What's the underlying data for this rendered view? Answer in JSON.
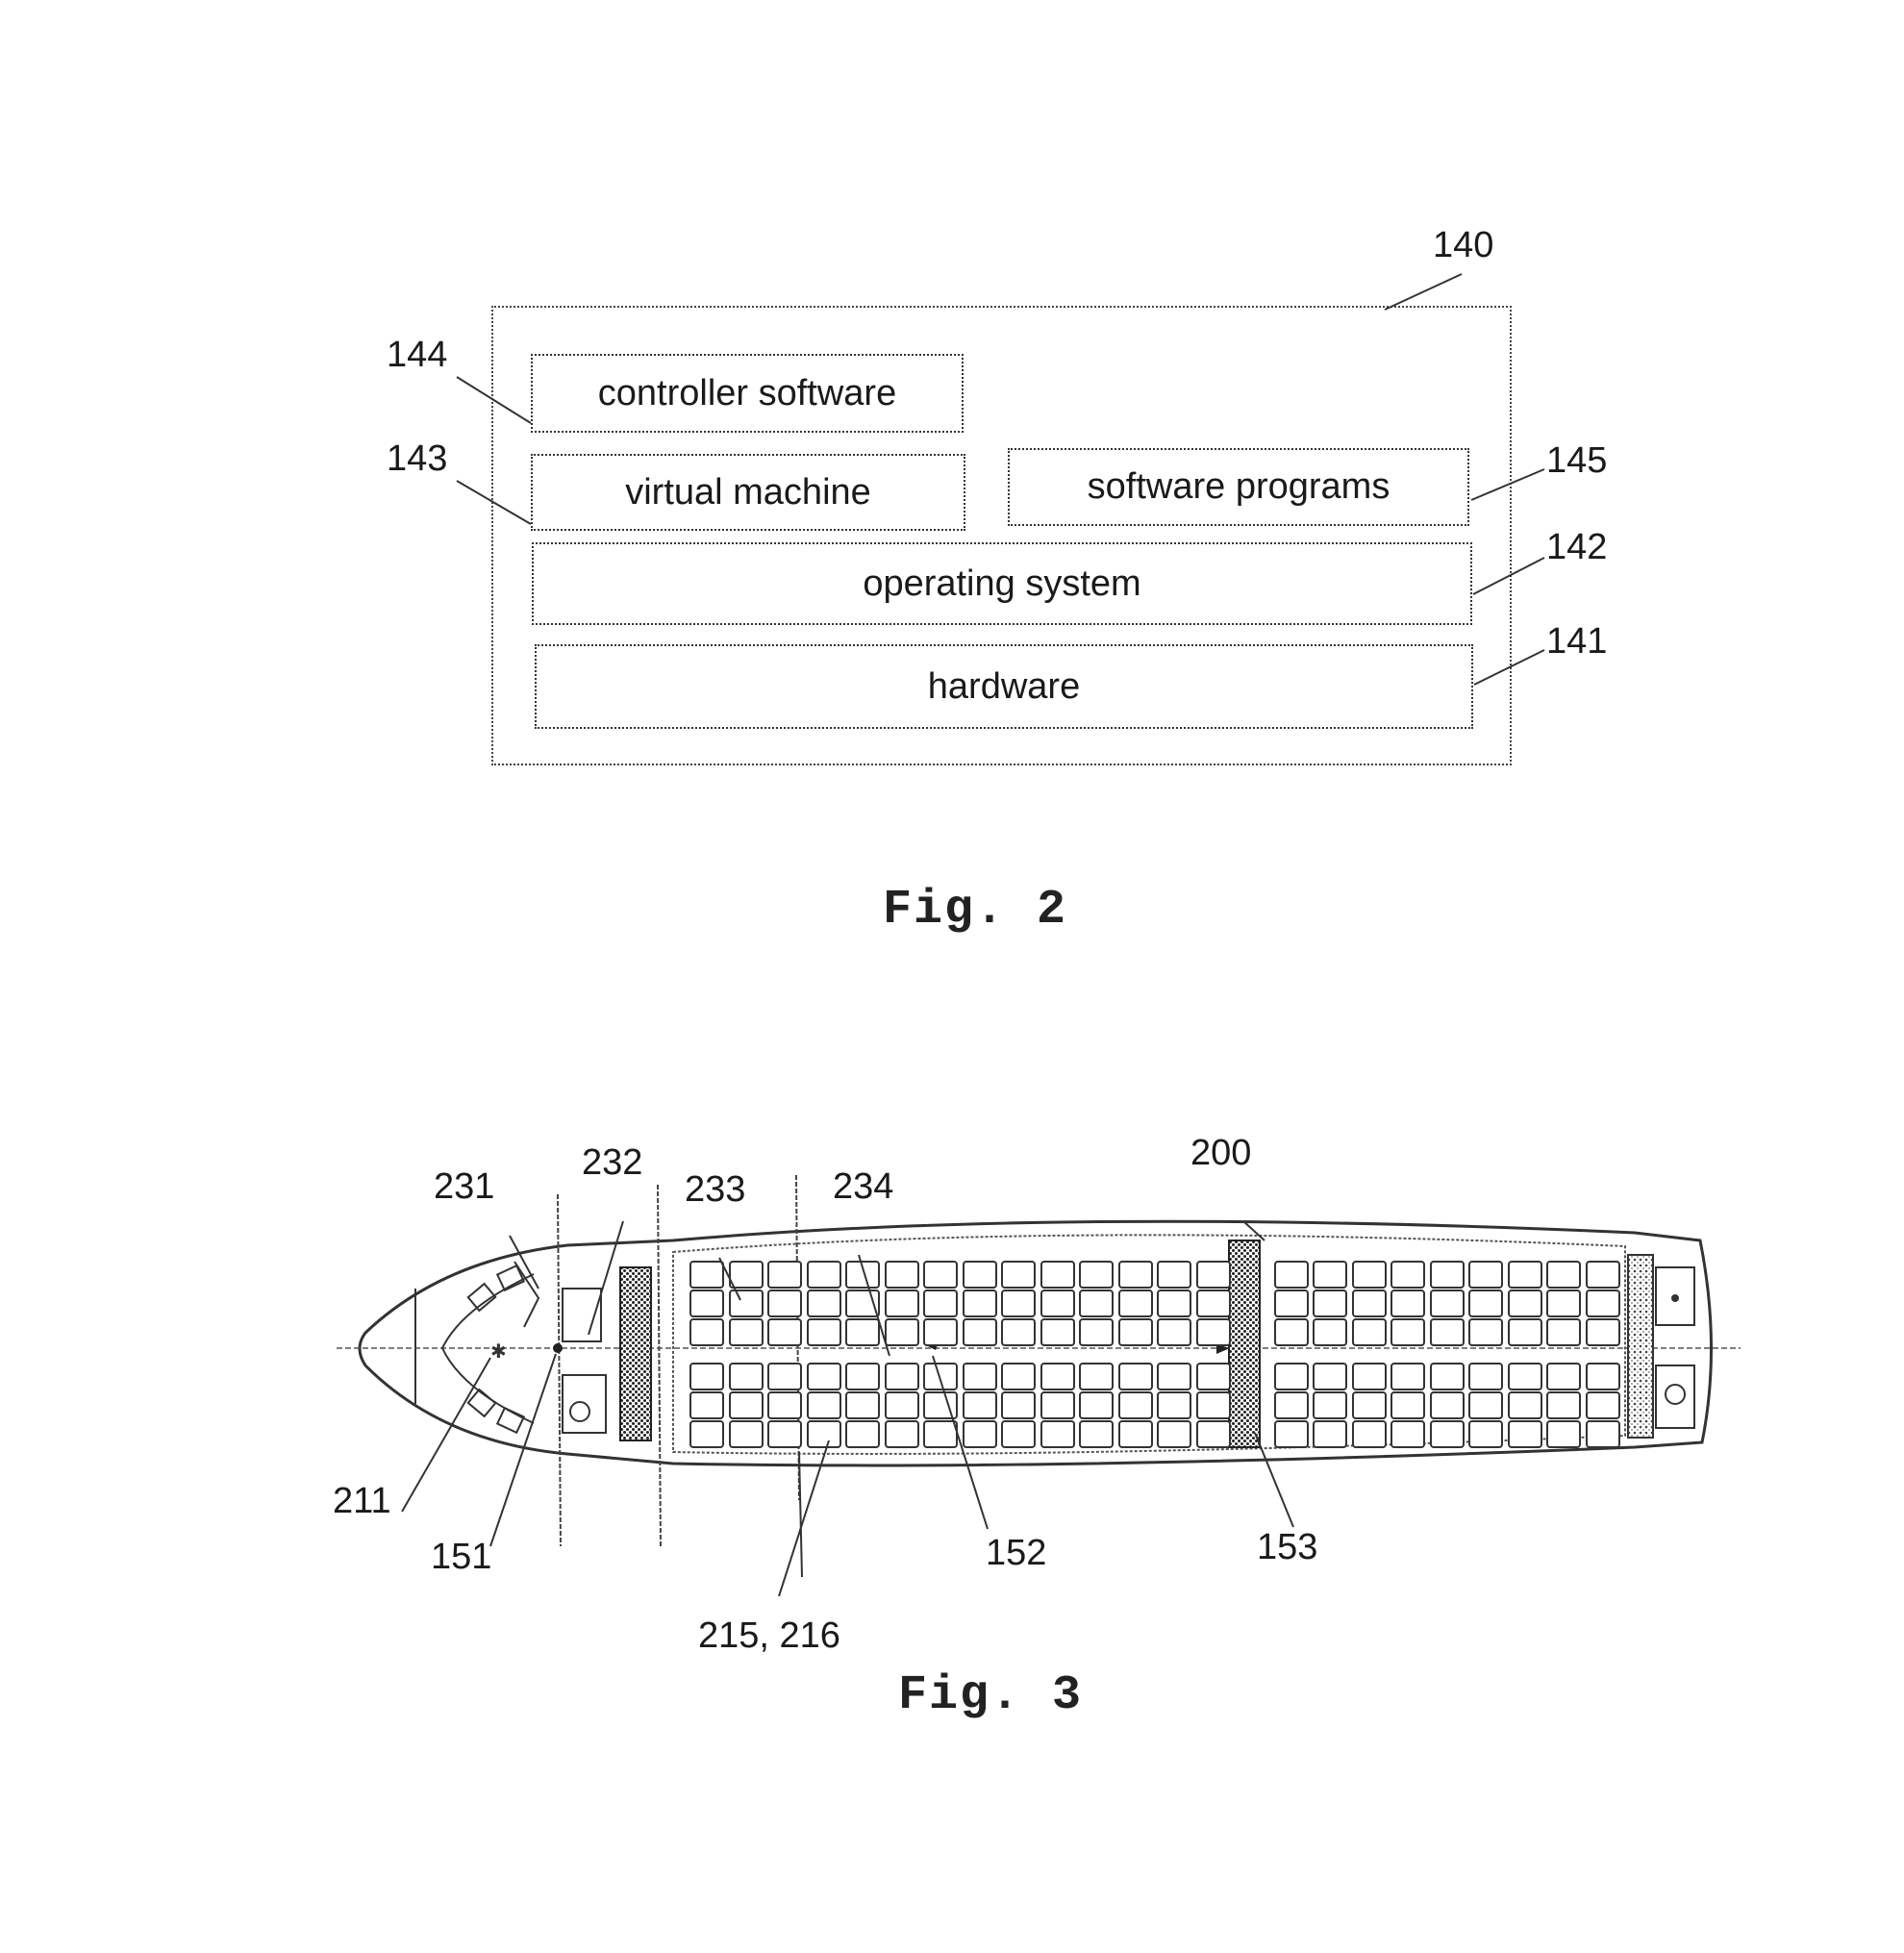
{
  "fig2": {
    "caption": "Fig. 2",
    "outer_ref": "140",
    "layers": [
      {
        "ref": "144",
        "label": "controller software"
      },
      {
        "ref": "143",
        "label": "virtual machine"
      },
      {
        "ref": "145",
        "label": "software programs"
      },
      {
        "ref": "142",
        "label": "operating system"
      },
      {
        "ref": "141",
        "label": "hardware"
      }
    ]
  },
  "fig3": {
    "caption": "Fig. 3",
    "refs": {
      "r231": "231",
      "r232": "232",
      "r233": "233",
      "r234": "234",
      "r200": "200",
      "r211": "211",
      "r151": "151",
      "r152": "152",
      "r153": "153",
      "r215_216": "215, 216"
    }
  }
}
